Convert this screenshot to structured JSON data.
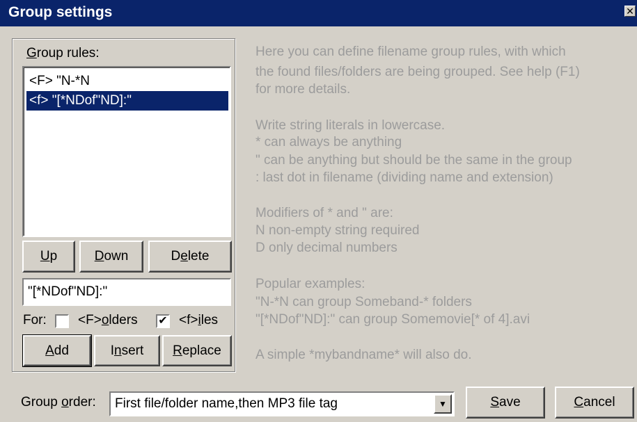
{
  "window": {
    "title": "Group settings",
    "close_glyph": "✕"
  },
  "group_rules": {
    "label_prefix": "",
    "label_mnemonic": "G",
    "label_rest": "roup rules:",
    "items": [
      {
        "text": "<F> \"N-*N",
        "selected": false
      },
      {
        "text": "<f> \"[*NDof\"ND]:\"",
        "selected": true
      }
    ],
    "edit_value": "\"[*NDof\"ND]:\""
  },
  "buttons": {
    "up": {
      "m": "U",
      "rest": "p"
    },
    "down": {
      "m": "D",
      "rest": "own"
    },
    "delete": {
      "pre": "D",
      "m": "e",
      "rest": "lete"
    },
    "add": {
      "m": "A",
      "rest": "dd"
    },
    "insert": {
      "pre": "I",
      "m": "n",
      "rest": "sert"
    },
    "replace": {
      "m": "R",
      "rest": "eplace"
    },
    "save": {
      "m": "S",
      "rest": "ave"
    },
    "cancel": {
      "m": "C",
      "rest": "ancel"
    }
  },
  "for_row": {
    "label": "For:",
    "folders": {
      "pre": "<F>",
      "m": "o",
      "rest": "lders",
      "checked": false
    },
    "files": {
      "pre": "<f>",
      "m": "i",
      "rest": "les",
      "checked": true,
      "mark": "✔"
    }
  },
  "help_lines": [
    "Here you can define filename group rules, with which",
    "the found files/folders are being grouped. See help (F1)",
    "for more details.",
    "Write string literals in lowercase.",
    "*  can always be anything",
    "\"  can be anything but should be the same in the group",
    ":  last dot in filename (dividing name and extension)",
    "Modifiers of * and \" are:",
    "N  non-empty string required",
    "D  only decimal numbers",
    "Popular examples:",
    "\"N-*N can group Someband-* folders",
    "\"[*NDof\"ND]:\" can group Somemovie[* of 4].avi",
    "A simple *mybandname* will also do."
  ],
  "group_order": {
    "pre": "Group ",
    "m": "o",
    "rest": "rder:",
    "value": "First file/folder name,then MP3 file tag",
    "arrow_glyph": "▼"
  }
}
